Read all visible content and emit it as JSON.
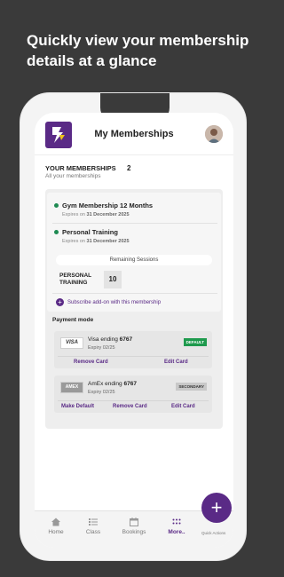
{
  "headline": "Quickly view your membership details at a glance",
  "appbar": {
    "title": "My Memberships"
  },
  "memberships": {
    "heading": "YOUR MEMBERSHIPS",
    "count": "2",
    "subheading": "All your memberships",
    "items": [
      {
        "name": "Gym Membership 12 Months",
        "expires_label": "Expires on",
        "expires_date": "31 December 2025"
      },
      {
        "name": "Personal Training",
        "expires_label": "Expires on",
        "expires_date": "31 December 2025"
      }
    ],
    "remaining_label": "Remaining Sessions",
    "session_name": "PERSONAL TRAINING",
    "session_count": "10",
    "addon_label": "Subscribe add-on with this membership"
  },
  "payment": {
    "heading": "Payment mode",
    "cards": [
      {
        "brand": "VISA",
        "title": "Visa ending",
        "last4": "6767",
        "expiry": "Expiry 02/25",
        "badge": "DEFAULT",
        "actions": [
          "Remove Card",
          "Edit Card"
        ]
      },
      {
        "brand": "AMEX",
        "title": "AmEx ending",
        "last4": "6767",
        "expiry": "Expiry 02/25",
        "badge": "SECONDARY",
        "actions": [
          "Make Default",
          "Remove Card",
          "Edit Card"
        ]
      }
    ]
  },
  "tabs": [
    {
      "label": "Home",
      "icon": "home-icon"
    },
    {
      "label": "Class",
      "icon": "list-icon"
    },
    {
      "label": "Bookings",
      "icon": "calendar-icon"
    },
    {
      "label": "More..",
      "icon": "more-dots-icon",
      "active": true
    }
  ],
  "quick_actions_label": "Quick Actions",
  "colors": {
    "brand_purple": "#5a2a86",
    "active_green": "#1e8a52",
    "default_badge": "#1e9a4d",
    "background": "#3a3a3a"
  }
}
